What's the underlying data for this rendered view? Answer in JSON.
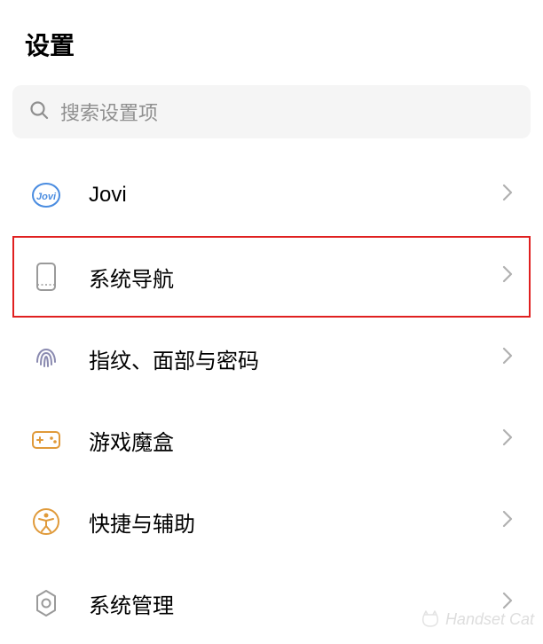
{
  "header": {
    "title": "设置"
  },
  "search": {
    "placeholder": "搜索设置项"
  },
  "items": [
    {
      "label": "Jovi"
    },
    {
      "label": "系统导航"
    },
    {
      "label": "指纹、面部与密码"
    },
    {
      "label": "游戏魔盒"
    },
    {
      "label": "快捷与辅助"
    },
    {
      "label": "系统管理"
    }
  ],
  "watermark": {
    "text": "Handset Cat"
  }
}
